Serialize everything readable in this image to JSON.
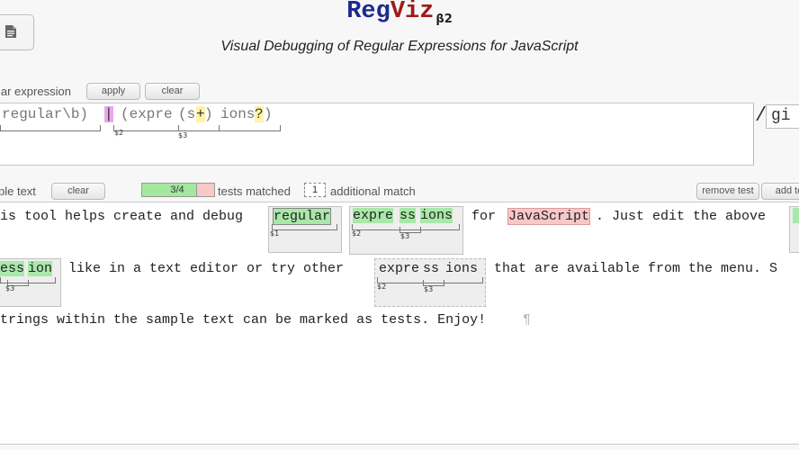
{
  "header": {
    "logo_reg": "Reg",
    "logo_viz": "Viz",
    "logo_version": "β2",
    "subtitle": "Visual Debugging of Regular Expressions for JavaScript"
  },
  "regex_section": {
    "label": "lar expression",
    "apply_label": "apply",
    "clear_label": "clear",
    "segments": {
      "s1": "regular\\b)",
      "alt": "|",
      "s2": "(expre",
      "s3": "(s",
      "s4": "+",
      "s5": ")",
      "s6": "ions",
      "s7": "?",
      "s8": ")"
    },
    "group_labels": {
      "g2": "$2",
      "g3": "$3"
    },
    "flags_slash": "/",
    "flags": "gi"
  },
  "sample_section": {
    "label": "ple text",
    "clear_label": "clear",
    "tests_progress": "3/4",
    "tests_passed": 3,
    "tests_total": 4,
    "tests_label": "tests matched",
    "additional_count": "1",
    "additional_label": "additional match",
    "remove_test_label": "remove test",
    "add_test_label": "add te"
  },
  "sample_text": {
    "line1_a": "is tool helps create and debug",
    "m1": "regular",
    "m2a": "expre",
    "m2b": "ss",
    "m2c": "ions",
    "line1_b": "for",
    "m3": "JavaScript",
    "line1_c": ". Just edit the above",
    "line2_a_1": "e",
    "line2_a_2": "ss",
    "line2_a_3": "ion",
    "line2_b": "like in a text editor or try other",
    "m5a": "expre",
    "m5b": "ss",
    "m5c": "ions",
    "line2_c": "that are available from the menu. S",
    "line3": "trings within the sample text can be marked as tests. Enjoy!",
    "pilcrow": "¶",
    "lbl_1": "$1",
    "lbl_2": "$2",
    "lbl_3": "$3"
  },
  "colors": {
    "match_green": "#a8e8a8",
    "fail_red": "#f8c8c8",
    "logo_blue": "#1d2a8c",
    "logo_red": "#a01a1a"
  }
}
